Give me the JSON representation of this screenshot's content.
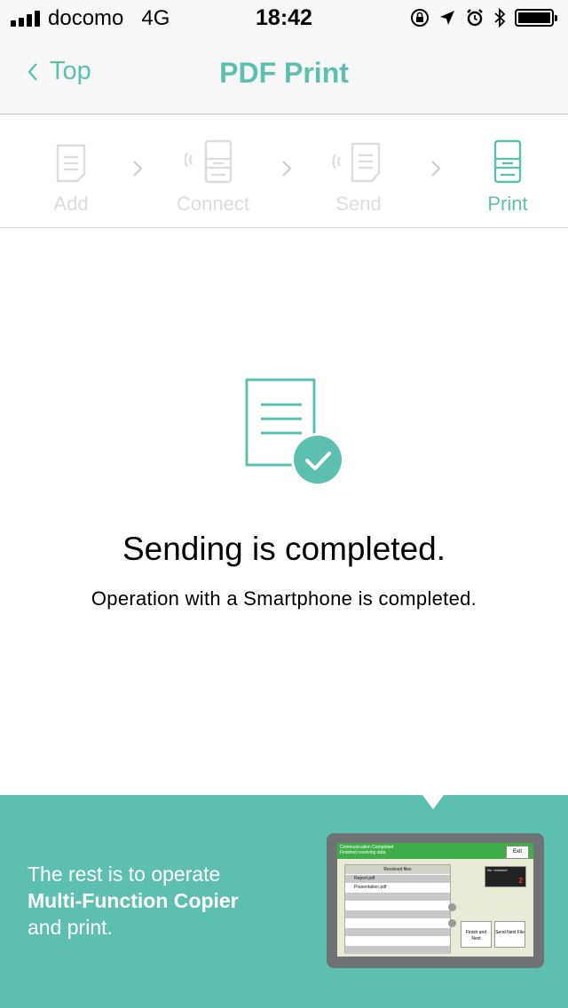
{
  "status_bar": {
    "carrier": "docomo",
    "network": "4G",
    "time": "18:42"
  },
  "nav": {
    "back_label": "Top",
    "title": "PDF Print"
  },
  "steps": [
    {
      "label": "Add",
      "icon": "document-icon",
      "active": false
    },
    {
      "label": "Connect",
      "icon": "printer-wireless-icon",
      "active": false
    },
    {
      "label": "Send",
      "icon": "document-wireless-icon",
      "active": false
    },
    {
      "label": "Print",
      "icon": "printer-icon",
      "active": true
    }
  ],
  "main": {
    "icon": "document-check-icon",
    "headline": "Sending is completed.",
    "subline": "Operation with a Smartphone is completed."
  },
  "bottom": {
    "line1": "The rest is to operate",
    "line2": "Multi-Function Copier",
    "line3": "and print.",
    "device_screen": {
      "header_line1": "Communication Completed",
      "header_line2": "Finished receiving data",
      "exit": "Exit",
      "list_header": "Received files",
      "files": [
        "Report.pdf",
        "Presentation.pdf"
      ],
      "counter_label": "No. received",
      "counter_value": "2",
      "button_finish": "Finish and Next",
      "button_send": "Send Next File"
    }
  },
  "colors": {
    "accent": "#5dbfb0",
    "inactive": "#dcdcdc",
    "banner": "#5dbfb0"
  }
}
